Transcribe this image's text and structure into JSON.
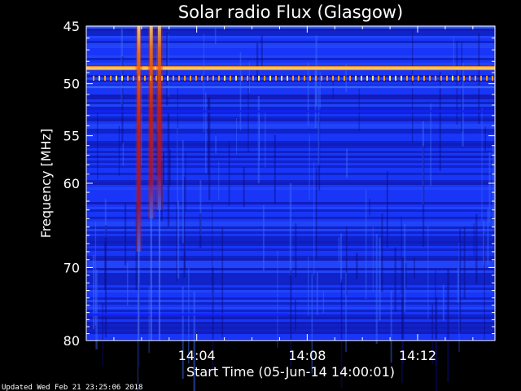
{
  "chart_data": {
    "type": "heatmap",
    "title": "Solar radio Flux (Glasgow)",
    "xlabel": "Start Time (05-Jun-14 14:00:01)",
    "ylabel": "Frequency [MHz]",
    "x_unit": "minutes after 14:00:01",
    "xlim": [
      0,
      14.8
    ],
    "ylim": [
      45,
      80
    ],
    "y_scale": "log",
    "x_ticks": [
      {
        "value": 4,
        "label": "14:04"
      },
      {
        "value": 8,
        "label": "14:08"
      },
      {
        "value": 12,
        "label": "14:12"
      }
    ],
    "y_ticks": [
      {
        "value": 45,
        "label": "45"
      },
      {
        "value": 50,
        "label": "50"
      },
      {
        "value": 55,
        "label": "55"
      },
      {
        "value": 60,
        "label": "60"
      },
      {
        "value": 70,
        "label": "70"
      },
      {
        "value": 80,
        "label": "80"
      }
    ],
    "colormap": [
      "#00008c",
      "#1420ff",
      "#3c6cff",
      "#d01e00",
      "#ff7a00",
      "#ffe47a",
      "#ffffff"
    ],
    "background_band": "#1830f0",
    "features": [
      {
        "kind": "vertical_burst",
        "x": 1.9,
        "y_range": [
          45,
          68
        ],
        "intensity": 0.85
      },
      {
        "kind": "vertical_burst",
        "x": 2.35,
        "y_range": [
          45,
          64
        ],
        "intensity": 0.8
      },
      {
        "kind": "vertical_burst",
        "x": 2.65,
        "y_range": [
          45,
          63
        ],
        "intensity": 0.75
      },
      {
        "kind": "horizontal_band",
        "y": 48.6,
        "x_range": [
          0,
          14.8
        ],
        "intensity": 1.0
      },
      {
        "kind": "horizontal_band",
        "y": 50.3,
        "x_range": [
          0,
          14.8
        ],
        "intensity": 0.65
      },
      {
        "kind": "horizontal_band",
        "y": 52.6,
        "x_range": [
          0,
          14.8
        ],
        "intensity": 0.45
      },
      {
        "kind": "horizontal_band",
        "y": 76.3,
        "x_range": [
          0,
          7.3
        ],
        "intensity": 0.45
      },
      {
        "kind": "horizontal_band",
        "y": 45.1,
        "x_range": [
          0,
          14.8
        ],
        "intensity": 0.5
      }
    ],
    "footer": "Updated Wed Feb 21 23:25:06 2018"
  }
}
